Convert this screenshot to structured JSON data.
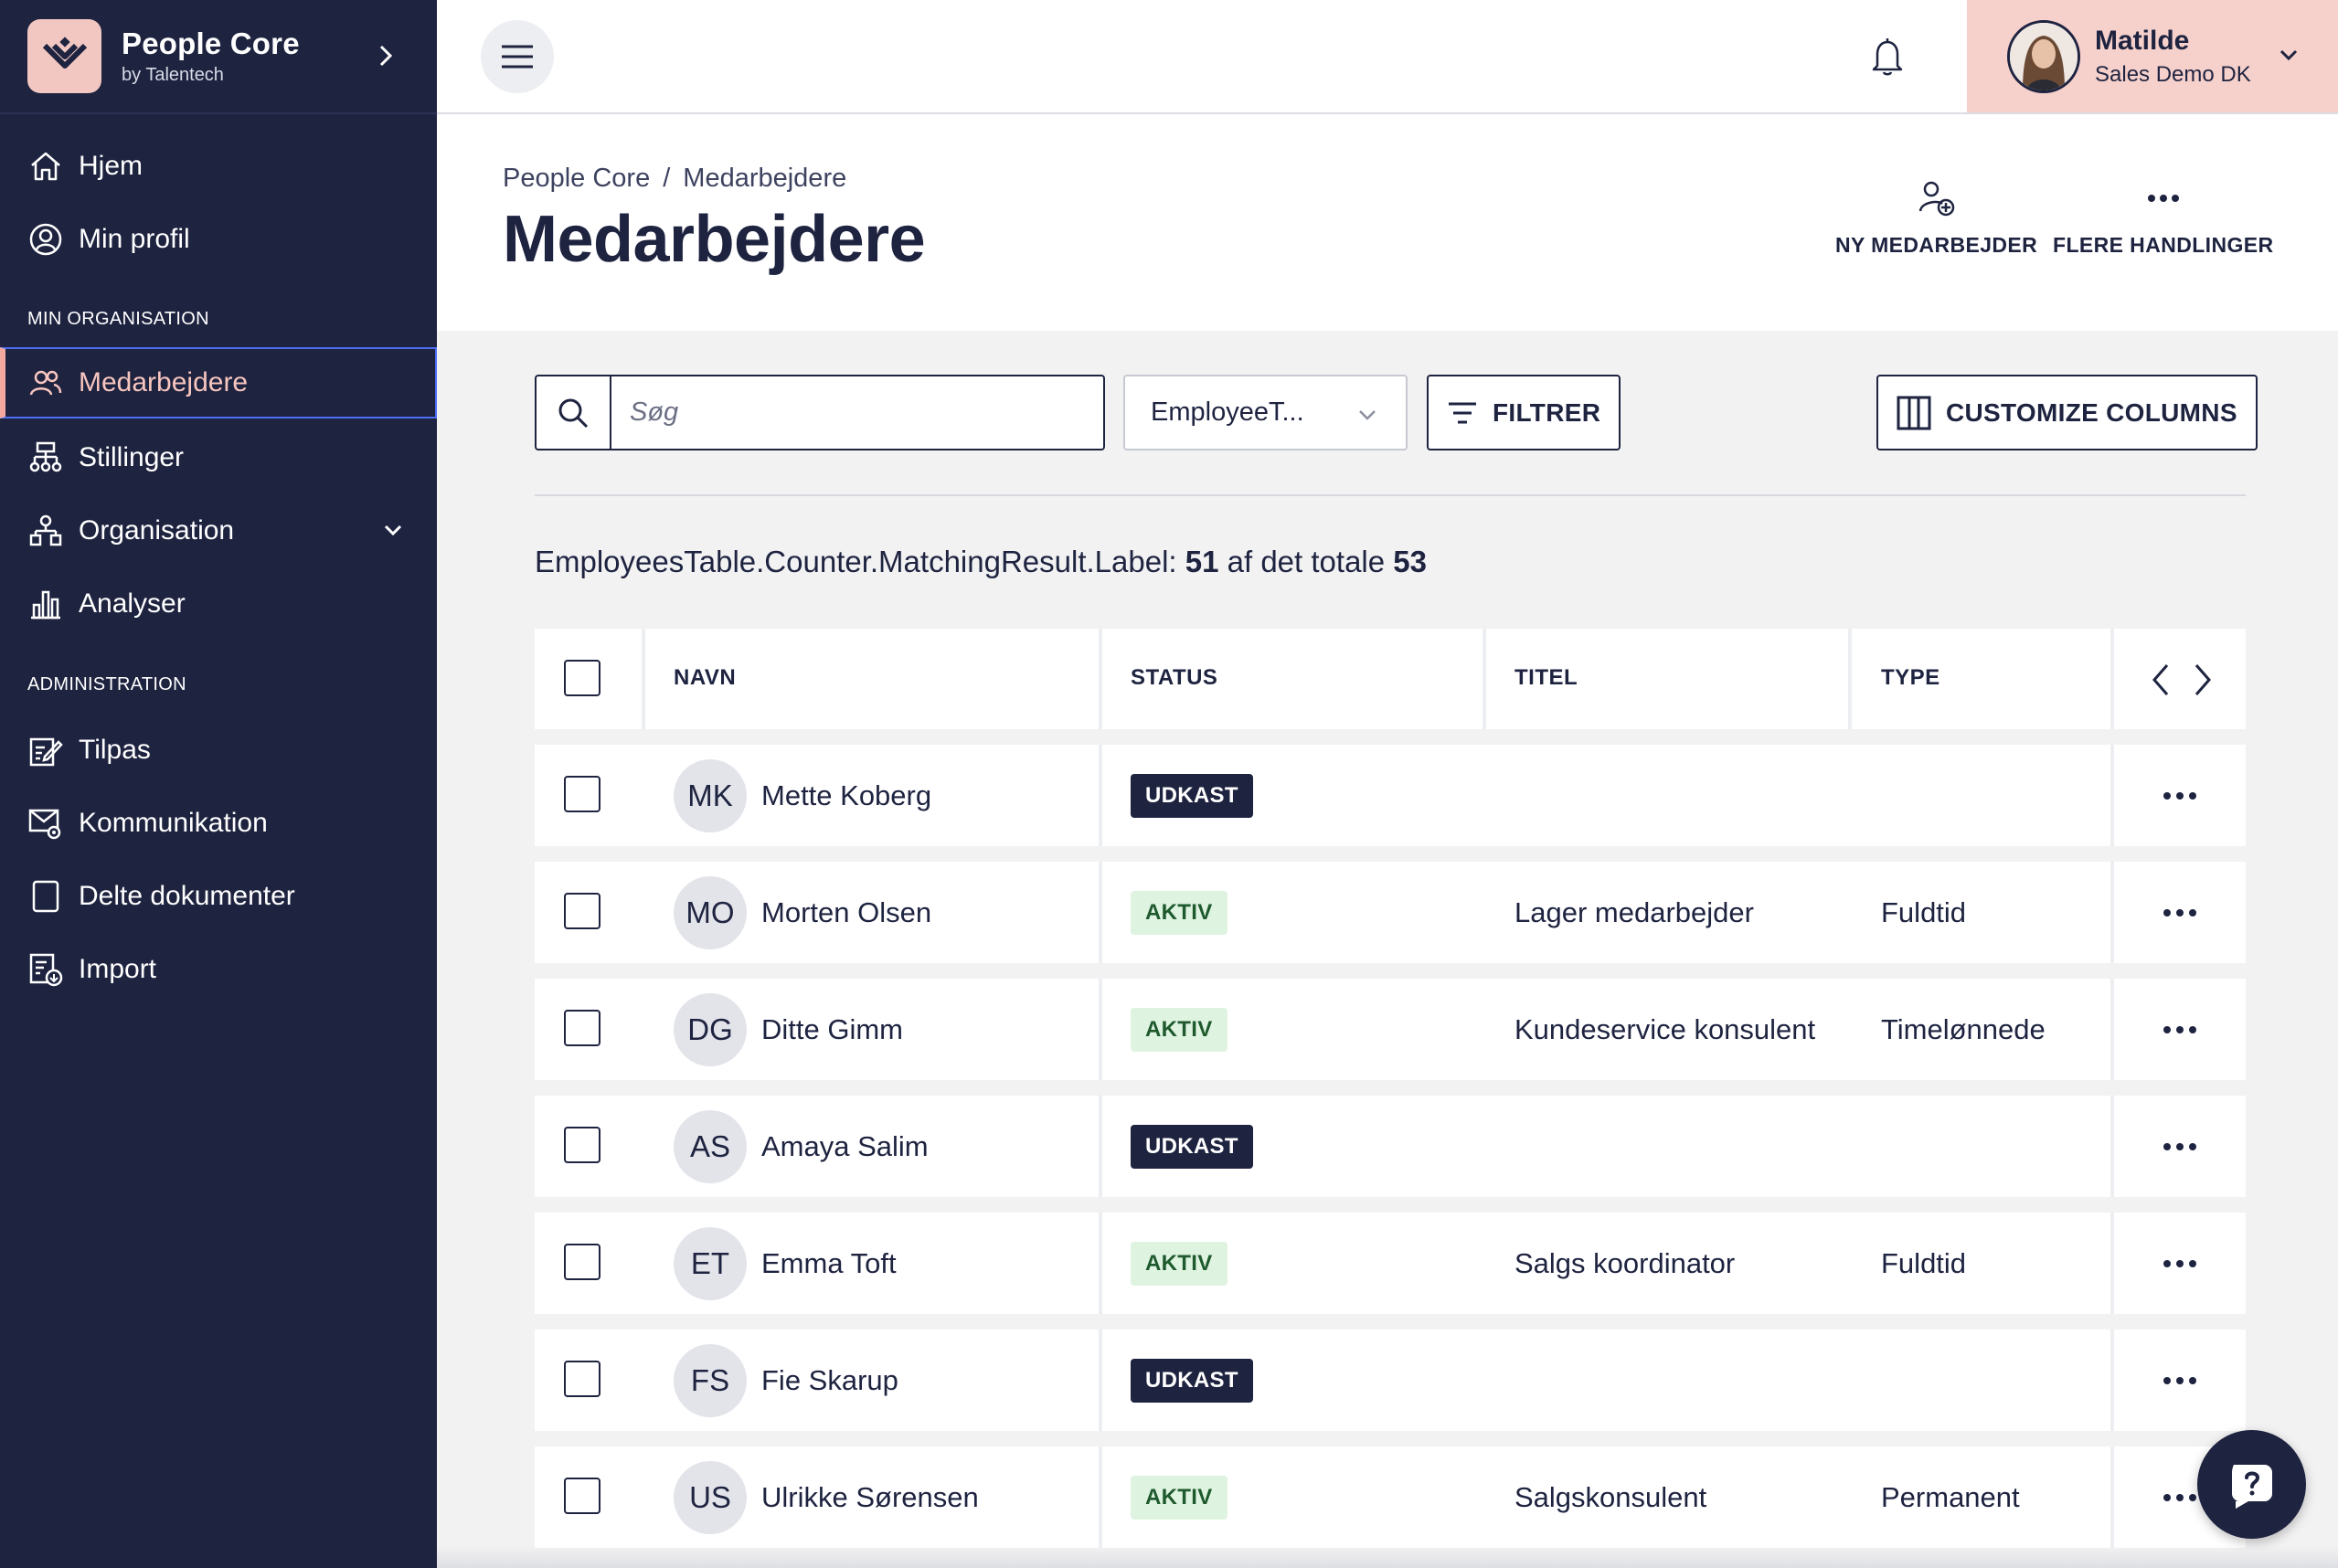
{
  "brand": {
    "name": "People Core",
    "sub": "by Talentech"
  },
  "sidebar": {
    "items_top": [
      {
        "label": "Hjem",
        "icon": "home-icon"
      },
      {
        "label": "Min profil",
        "icon": "user-circle-icon"
      }
    ],
    "section_org": "MIN ORGANISATION",
    "items_org": [
      {
        "label": "Medarbejdere",
        "icon": "people-icon",
        "active": true
      },
      {
        "label": "Stillinger",
        "icon": "org-tree-icon"
      },
      {
        "label": "Organisation",
        "icon": "hierarchy-icon"
      },
      {
        "label": "Analyser",
        "icon": "bar-chart-icon"
      }
    ],
    "section_admin": "ADMINISTRATION",
    "items_admin": [
      {
        "label": "Tilpas",
        "icon": "edit-icon"
      },
      {
        "label": "Kommunikation",
        "icon": "mail-settings-icon"
      },
      {
        "label": "Delte dokumenter",
        "icon": "document-icon"
      },
      {
        "label": "Import",
        "icon": "import-icon"
      }
    ]
  },
  "user": {
    "name": "Matilde",
    "org": "Sales Demo DK"
  },
  "breadcrumb": {
    "root": "People Core",
    "sep": "/",
    "current": "Medarbejdere"
  },
  "page": {
    "title": "Medarbejdere"
  },
  "actions": {
    "new_employee": "NY MEDARBEJDER",
    "more_actions": "FLERE HANDLINGER"
  },
  "toolbar": {
    "search_placeholder": "Søg",
    "type_select": "EmployeeT...",
    "filter": "FILTRER",
    "customize": "CUSTOMIZE COLUMNS"
  },
  "counter": {
    "label": "EmployeesTable.Counter.MatchingResult.Label:",
    "matching": "51",
    "of_total": "af det totale",
    "total": "53"
  },
  "table": {
    "headers": {
      "name": "NAVN",
      "status": "STATUS",
      "title": "TITEL",
      "type": "TYPE"
    },
    "rows": [
      {
        "initials": "MK",
        "name": "Mette Koberg",
        "status": "UDKAST",
        "status_kind": "draft",
        "title": "",
        "type": ""
      },
      {
        "initials": "MO",
        "name": "Morten Olsen",
        "status": "AKTIV",
        "status_kind": "active",
        "title": "Lager medarbejder",
        "type": "Fuldtid"
      },
      {
        "initials": "DG",
        "name": "Ditte Gimm",
        "status": "AKTIV",
        "status_kind": "active",
        "title": "Kundeservice konsulent",
        "type": "Timelønnede"
      },
      {
        "initials": "AS",
        "name": "Amaya Salim",
        "status": "UDKAST",
        "status_kind": "draft",
        "title": "",
        "type": ""
      },
      {
        "initials": "ET",
        "name": "Emma Toft",
        "status": "AKTIV",
        "status_kind": "active",
        "title": "Salgs koordinator",
        "type": "Fuldtid"
      },
      {
        "initials": "FS",
        "name": "Fie Skarup",
        "status": "UDKAST",
        "status_kind": "draft",
        "title": "",
        "type": ""
      },
      {
        "initials": "US",
        "name": "Ulrikke Sørensen",
        "status": "AKTIV",
        "status_kind": "active",
        "title": "Salgskonsulent",
        "type": "Permanent"
      }
    ]
  },
  "colors": {
    "sidebar_bg": "#1e2340",
    "accent_pink": "#f6d0cb",
    "active_badge_bg": "#dff3e1",
    "draft_badge_bg": "#1e2340"
  }
}
